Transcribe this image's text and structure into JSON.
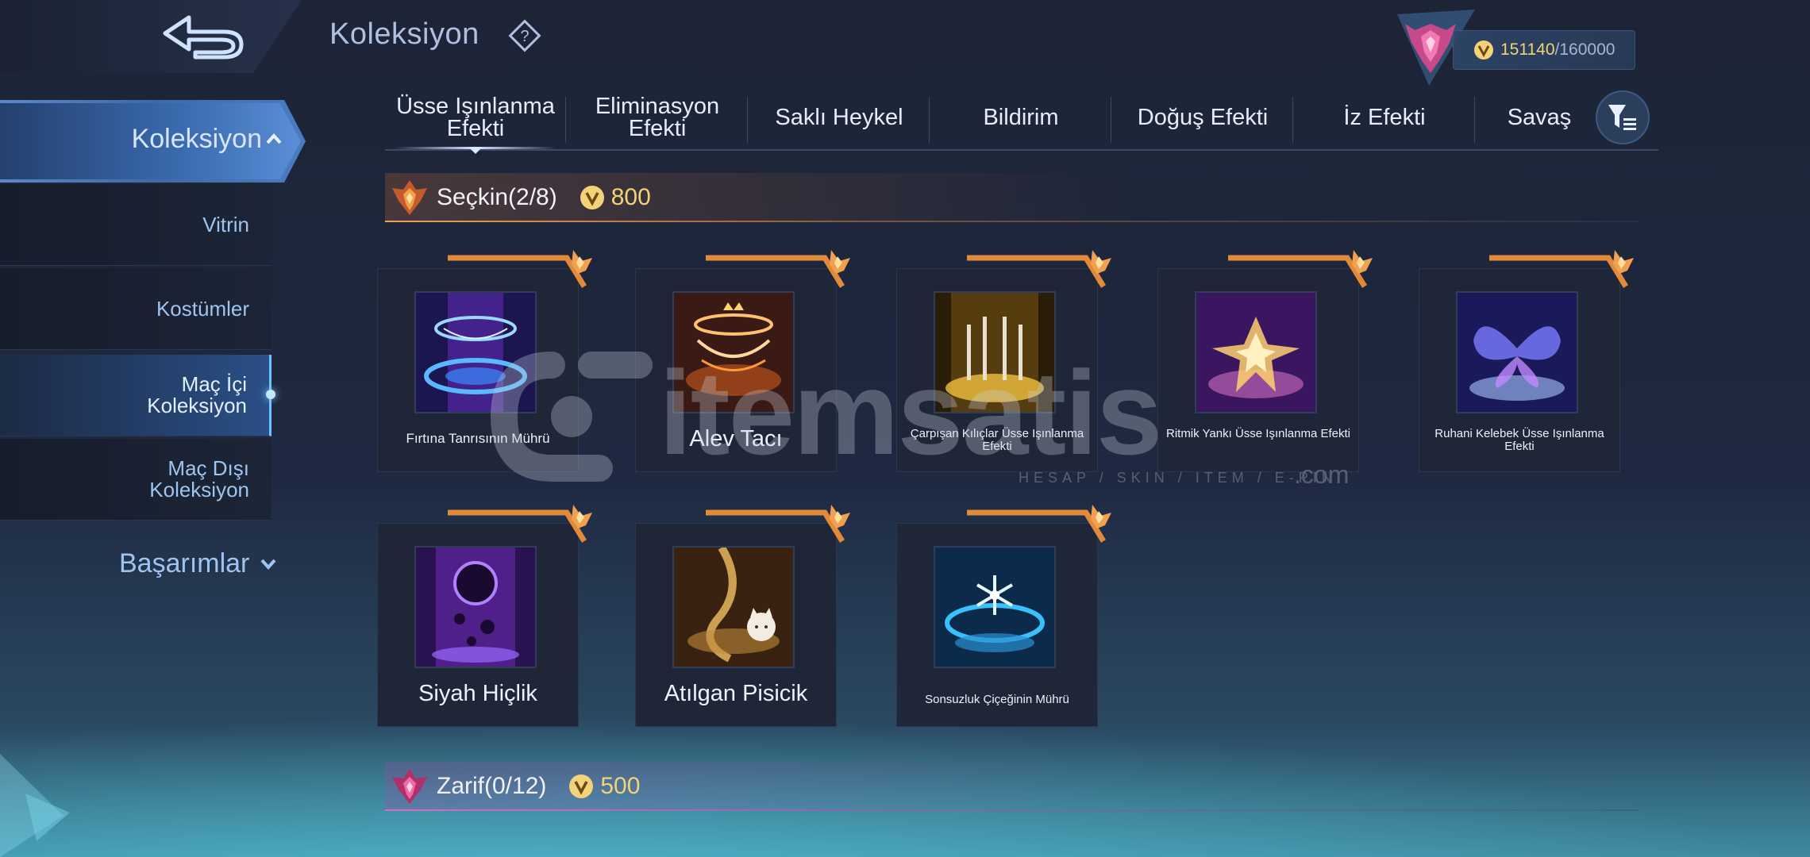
{
  "page": {
    "title": "Koleksiyon"
  },
  "currency": {
    "current": "151140",
    "separator": "/",
    "max": "160000",
    "icon": "coin-icon",
    "rank_icon": "rank-emblem-icon"
  },
  "sidebar": {
    "main_label": "Koleksiyon",
    "items": [
      {
        "label": "Vitrin"
      },
      {
        "label": "Kostümler"
      },
      {
        "label": "Maç İçi\nKoleksiyon",
        "line1": "Maç İçi",
        "line2": "Koleksiyon",
        "active": true
      },
      {
        "label": "Maç Dışı\nKoleksiyon",
        "line1": "Maç Dışı",
        "line2": "Koleksiyon"
      }
    ],
    "achievements_label": "Başarımlar"
  },
  "tabs": [
    {
      "line1": "Üsse Işınlanma",
      "line2": "Efekti",
      "active": true
    },
    {
      "line1": "Eliminasyon",
      "line2": "Efekti"
    },
    {
      "line1": "Saklı Heykel"
    },
    {
      "line1": "Bildirim"
    },
    {
      "line1": "Doğuş Efekti"
    },
    {
      "line1": "İz Efekti"
    },
    {
      "line1": "Savaş"
    }
  ],
  "sections": [
    {
      "name": "Seçkin(2/8)",
      "price": "800"
    },
    {
      "name": "Zarif(0/12)",
      "price": "500"
    }
  ],
  "cards": [
    {
      "label": "Fırtına Tanrısının Mührü"
    },
    {
      "label": "Alev Tacı"
    },
    {
      "label": "Çarpışan Kılıçlar Üsse Işınlanma Efekti"
    },
    {
      "label": "Ritmik Yankı Üsse Işınlanma Efekti"
    },
    {
      "label": "Ruhani Kelebek Üsse Işınlanma Efekti"
    },
    {
      "label": "Siyah Hiçlik"
    },
    {
      "label": "Atılgan Pisicik"
    },
    {
      "label": "Sonsuzluk Çiçeğinin Mührü"
    }
  ],
  "watermark": {
    "text": "itemsatis",
    "sub": "HESAP / SKIN / ITEM / E-PIN",
    "com": ".com"
  },
  "colors": {
    "accent": "#5d88c8",
    "gold": "#f3d27a",
    "trim": "#e08a3a"
  }
}
